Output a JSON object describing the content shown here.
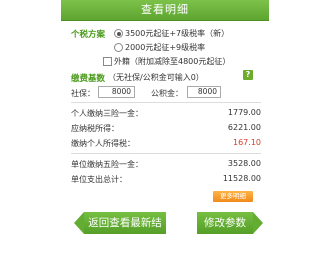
{
  "header": {
    "title": "查看明细"
  },
  "tax_scheme": {
    "label": "个税方案",
    "options": [
      {
        "label": "3500元起征+7级税率（新）",
        "selected": true
      },
      {
        "label": "2000元起征+9级税率",
        "selected": false
      }
    ],
    "foreign": {
      "label": "外籍（附加减除至4800元起征）",
      "checked": false
    }
  },
  "base": {
    "label": "缴费基数",
    "hint": "（无社保/公积金可输入0）",
    "help_icon": "?",
    "social_label": "社保：",
    "social_value": "8000",
    "fund_label": "公积金：",
    "fund_value": "8000"
  },
  "results": [
    {
      "label": "个人缴纳三险一金：",
      "value": "1779.00"
    },
    {
      "label": "应纳税所得：",
      "value": "6221.00"
    },
    {
      "label": "缴纳个人所得税：",
      "value": "167.10",
      "highlight": "#d43b2b"
    }
  ],
  "unit_results": [
    {
      "label": "单位缴纳五险一金：",
      "value": "3528.00"
    },
    {
      "label": "单位支出总计：",
      "value": "11528.00"
    }
  ],
  "more_button": "更多明细",
  "back_button": "返回查看最新结果",
  "edit_button": "修改参数",
  "colors": {
    "brand_green": "#5ea530",
    "accent_orange": "#f08a1a",
    "tax_red": "#d43b2b"
  }
}
